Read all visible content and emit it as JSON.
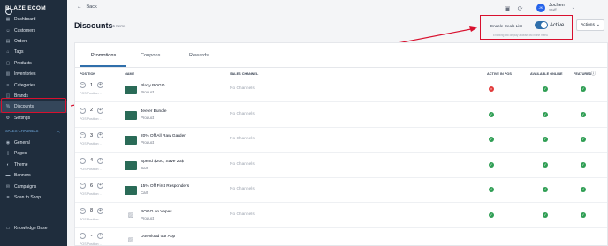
{
  "brand": {
    "name": "BLAZE ECOM"
  },
  "sidebar": {
    "items": [
      {
        "label": "Dashboard",
        "icon": "dashboard-icon"
      },
      {
        "label": "Customers",
        "icon": "users-icon"
      },
      {
        "label": "Orders",
        "icon": "orders-icon"
      },
      {
        "label": "Tags",
        "icon": "tag-icon"
      },
      {
        "label": "Products",
        "icon": "box-icon"
      },
      {
        "label": "Inventories",
        "icon": "inventory-icon"
      },
      {
        "label": "Categories",
        "icon": "categories-icon"
      },
      {
        "label": "Brands",
        "icon": "brands-icon"
      },
      {
        "label": "Discounts",
        "icon": "discount-icon"
      },
      {
        "label": "Settings",
        "icon": "gear-icon"
      }
    ],
    "section_label": "SALES CHANNELS",
    "channel_items": [
      {
        "label": "General",
        "icon": "general-icon"
      },
      {
        "label": "Pages",
        "icon": "pages-icon"
      },
      {
        "label": "Theme",
        "icon": "theme-icon"
      },
      {
        "label": "Banners",
        "icon": "banner-icon"
      },
      {
        "label": "Campaigns",
        "icon": "campaign-icon"
      },
      {
        "label": "Scan to Shop",
        "icon": "scan-icon"
      }
    ],
    "knowledge_base": "Knowledge Base"
  },
  "header": {
    "back_label": "Back",
    "user": {
      "initials": "JK",
      "name": "Jochen",
      "role": "Staff"
    },
    "title": "Discounts",
    "count": "15 Items",
    "deals": {
      "label": "Enable Deals List",
      "toggle_label": "Active",
      "note": "Enabling will display a deals list in the menu"
    },
    "actions_label": "Actions"
  },
  "tabs": [
    {
      "label": "Promotions"
    },
    {
      "label": "Coupons"
    },
    {
      "label": "Rewards"
    }
  ],
  "columns": {
    "position": "POSITION",
    "name": "NAME",
    "sales_channel": "SALES CHANNEL",
    "active_pos": "ACTIVE IN POS",
    "available_online": "AVAILABLE ONLINE",
    "featured": "FEATURED"
  },
  "pos_label": "POS Position: -",
  "rows": [
    {
      "pos": "1",
      "name": "Blazy BOGO",
      "type": "Product",
      "channel": "No Channels",
      "active": false,
      "online": true,
      "featured": true
    },
    {
      "pos": "2",
      "name": "Jeeter Bundle",
      "type": "Product",
      "channel": "No Channels",
      "active": true,
      "online": true,
      "featured": true
    },
    {
      "pos": "3",
      "name": "20% Off All Raw Garden",
      "type": "Product",
      "channel": "No Channels",
      "active": true,
      "online": true,
      "featured": true
    },
    {
      "pos": "4",
      "name": "Spend $200, Save 20$",
      "type": "Cart",
      "channel": "No Channels",
      "active": true,
      "online": true,
      "featured": true
    },
    {
      "pos": "6",
      "name": "15% Off First Responders",
      "type": "Cart",
      "channel": "No Channels",
      "active": true,
      "online": true,
      "featured": true
    },
    {
      "pos": "8",
      "name": "BOGO on Vapes",
      "type": "Product",
      "channel": "No Channels",
      "active": true,
      "online": true,
      "featured": true
    },
    {
      "pos": "-",
      "name": "Download our App",
      "type": "",
      "channel": "",
      "active": null,
      "online": null,
      "featured": null
    }
  ],
  "colors": {
    "sidebar": "#1f2d3d",
    "accent": "#2f6fab",
    "highlight": "#d8102e",
    "ok": "#2f9e54",
    "error": "#e23b3b"
  }
}
